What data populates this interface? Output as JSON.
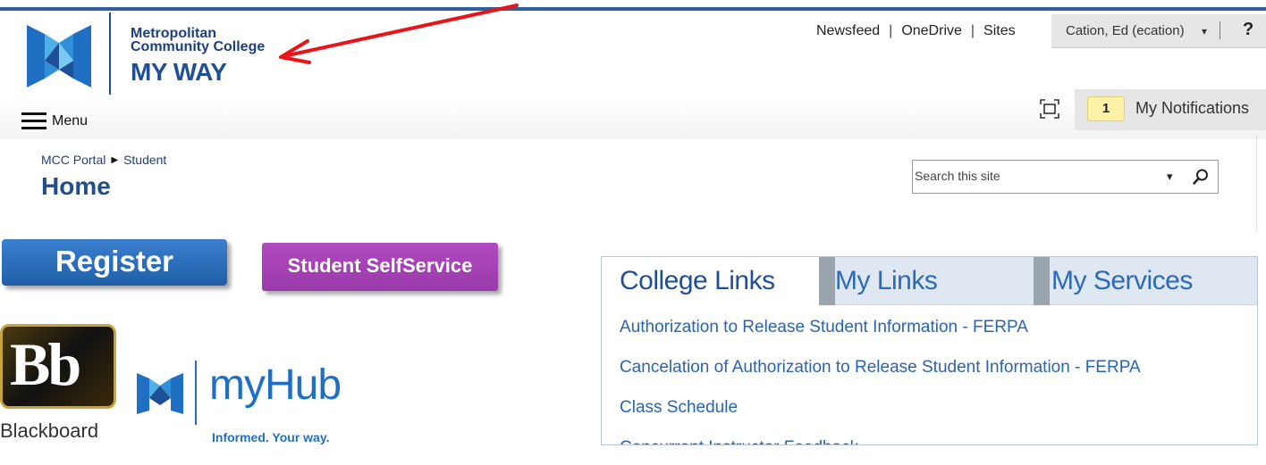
{
  "header": {
    "logo": {
      "line1": "Metropolitan",
      "line2": "Community College",
      "line3": "MY WAY",
      "colors": {
        "primary": "#1f3f7a",
        "accent": "#2f8fd8"
      }
    },
    "top_links": [
      "Newsfeed",
      "OneDrive",
      "Sites"
    ],
    "link_separator": "|",
    "user": {
      "name": "Cation, Ed (ecation)",
      "caret": "▾",
      "help": "?"
    }
  },
  "menubar": {
    "menu_label": "Menu",
    "focus_icon": "focus-on-content-icon",
    "notifications": {
      "count": "1",
      "label": "My Notifications"
    }
  },
  "breadcrumb": {
    "items": [
      "MCC Portal",
      "Student"
    ],
    "separator": "▶"
  },
  "page_title": "Home",
  "search": {
    "placeholder": "Search this site",
    "caret": "▾",
    "icon": "search-icon"
  },
  "quick_buttons": {
    "register": "Register",
    "self_service": "Student SelfService",
    "blackboard": {
      "mark": "Bb",
      "label": "Blackboard"
    },
    "myhub": {
      "name": "myHub",
      "tagline": "Informed. Your way."
    }
  },
  "tabs": {
    "items": [
      {
        "label": "College Links",
        "active": true
      },
      {
        "label": "My Links",
        "active": false
      },
      {
        "label": "My Services",
        "active": false
      }
    ],
    "links": [
      "Authorization to Release Student Information - FERPA",
      "Cancelation of Authorization to Release Student Information - FERPA",
      "Class Schedule",
      "Concurrent Instructor Feedback"
    ]
  },
  "annotation": {
    "arrow_color": "#e8141a"
  }
}
